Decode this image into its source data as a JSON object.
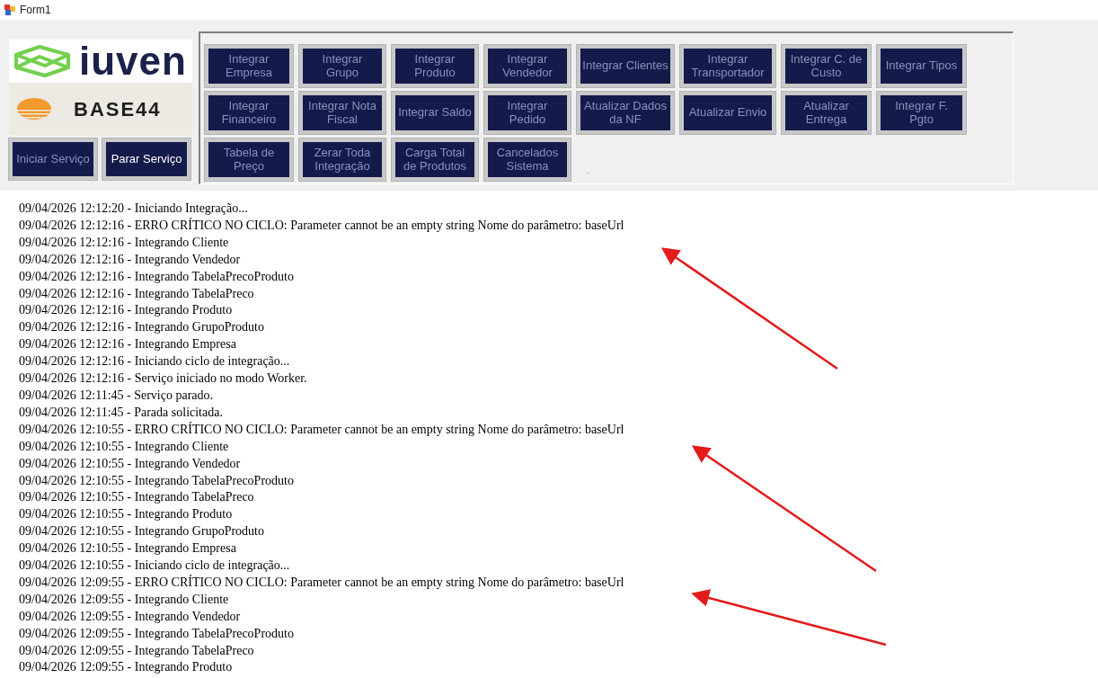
{
  "window": {
    "title": "Form1"
  },
  "logos": [
    {
      "kind": "iuven",
      "text": "iuven"
    },
    {
      "kind": "base44",
      "text": "BASE44"
    }
  ],
  "service_buttons": [
    {
      "label": "Iniciar Serviço",
      "disabled": true
    },
    {
      "label": "Parar Serviço",
      "disabled": false
    }
  ],
  "integration_buttons": [
    {
      "label": "Integrar Empresa",
      "disabled": true
    },
    {
      "label": "Integrar Grupo",
      "disabled": true
    },
    {
      "label": "Integrar Produto",
      "disabled": true
    },
    {
      "label": "Integrar Vendedor",
      "disabled": true
    },
    {
      "label": "Integrar Clientes",
      "disabled": true
    },
    {
      "label": "Integrar Transportador",
      "disabled": true
    },
    {
      "label": "Integrar C. de Custo",
      "disabled": true
    },
    {
      "label": "Integrar Tipos",
      "disabled": true
    },
    {
      "label": "Integrar Financeiro",
      "disabled": true
    },
    {
      "label": "Integrar Nota Fiscal",
      "disabled": true
    },
    {
      "label": "Integrar Saldo",
      "disabled": true
    },
    {
      "label": "Integrar Pedido",
      "disabled": true
    },
    {
      "label": "Atualizar Dados da NF",
      "disabled": true
    },
    {
      "label": "Atualizar Envio",
      "disabled": true
    },
    {
      "label": "Atualizar Entrega",
      "disabled": true
    },
    {
      "label": "Integrar F. Pgto",
      "disabled": true
    },
    {
      "label": "Tabela de Preço",
      "disabled": true
    },
    {
      "label": "Zerar Toda Integração",
      "disabled": true
    },
    {
      "label": "Carga Total de Produtos",
      "disabled": true
    },
    {
      "label": "Cancelados Sistema",
      "disabled": true
    }
  ],
  "panel_mark": ".",
  "log_lines": [
    "09/04/2026 12:12:20 - Iniciando Integração...",
    "09/04/2026 12:12:16 - ERRO CRÍTICO NO CICLO: Parameter cannot be an empty string Nome do parâmetro: baseUrl",
    "09/04/2026 12:12:16 - Integrando Cliente",
    "09/04/2026 12:12:16 - Integrando Vendedor",
    "09/04/2026 12:12:16 - Integrando TabelaPrecoProduto",
    "09/04/2026 12:12:16 - Integrando TabelaPreco",
    "09/04/2026 12:12:16 - Integrando Produto",
    "09/04/2026 12:12:16 - Integrando GrupoProduto",
    "09/04/2026 12:12:16 - Integrando Empresa",
    "09/04/2026 12:12:16 - Iniciando ciclo de integração...",
    "09/04/2026 12:12:16 - Serviço iniciado no modo Worker.",
    "09/04/2026 12:11:45 - Serviço parado.",
    "09/04/2026 12:11:45 - Parada solicitada.",
    "09/04/2026 12:10:55 - ERRO CRÍTICO NO CICLO: Parameter cannot be an empty string Nome do parâmetro: baseUrl",
    "09/04/2026 12:10:55 - Integrando Cliente",
    "09/04/2026 12:10:55 - Integrando Vendedor",
    "09/04/2026 12:10:55 - Integrando TabelaPrecoProduto",
    "09/04/2026 12:10:55 - Integrando TabelaPreco",
    "09/04/2026 12:10:55 - Integrando Produto",
    "09/04/2026 12:10:55 - Integrando GrupoProduto",
    "09/04/2026 12:10:55 - Integrando Empresa",
    "09/04/2026 12:10:55 - Iniciando ciclo de integração...",
    "09/04/2026 12:09:55 - ERRO CRÍTICO NO CICLO: Parameter cannot be an empty string Nome do parâmetro: baseUrl",
    "09/04/2026 12:09:55 - Integrando Cliente",
    "09/04/2026 12:09:55 - Integrando Vendedor",
    "09/04/2026 12:09:55 - Integrando TabelaPrecoProduto",
    "09/04/2026 12:09:55 - Integrando TabelaPreco",
    "09/04/2026 12:09:55 - Integrando Produto"
  ],
  "annotations": [
    {
      "kind": "arrow"
    },
    {
      "kind": "arrow"
    },
    {
      "kind": "arrow"
    }
  ]
}
